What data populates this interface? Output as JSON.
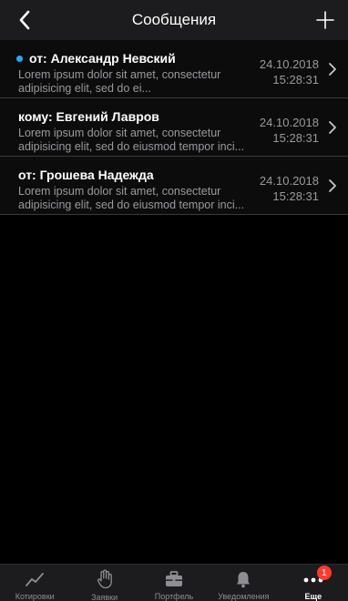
{
  "header": {
    "title": "Сообщения",
    "back_icon": "chevron-left-icon",
    "add_icon": "plus-icon"
  },
  "messages": [
    {
      "sender": "от: Александр Невский",
      "preview": "Lorem ipsum dolor sit amet, consectetur adipisicing elit, sed do ei...",
      "date": "24.10.2018",
      "time": "15:28:31",
      "unread": true
    },
    {
      "sender": "кому: Евгений Лавров",
      "preview": "Lorem ipsum dolor sit amet, consectetur adipisicing elit, sed do eiusmod tempor inci...",
      "date": "24.10.2018",
      "time": "15:28:31",
      "unread": false
    },
    {
      "sender": "от: Грошева Надежда",
      "preview": "Lorem ipsum dolor sit amet, consectetur adipisicing elit, sed do eiusmod tempor inci...",
      "date": "24.10.2018",
      "time": "15:28:31",
      "unread": false
    }
  ],
  "tabbar": {
    "tabs": [
      {
        "label": "Котировки",
        "icon": "chart-line-icon"
      },
      {
        "label": "Заявки",
        "icon": "hand-icon"
      },
      {
        "label": "Портфель",
        "icon": "briefcase-icon"
      },
      {
        "label": "Уведомления",
        "icon": "bell-icon"
      },
      {
        "label": "Еще",
        "icon": "more-dots-icon",
        "badge": "1",
        "active": true
      }
    ]
  },
  "colors": {
    "background": "#000000",
    "bar": "#1c1c1e",
    "unread_dot": "#2aa8ff",
    "badge": "#ff3b30",
    "secondary_text": "#9a9a9f"
  }
}
